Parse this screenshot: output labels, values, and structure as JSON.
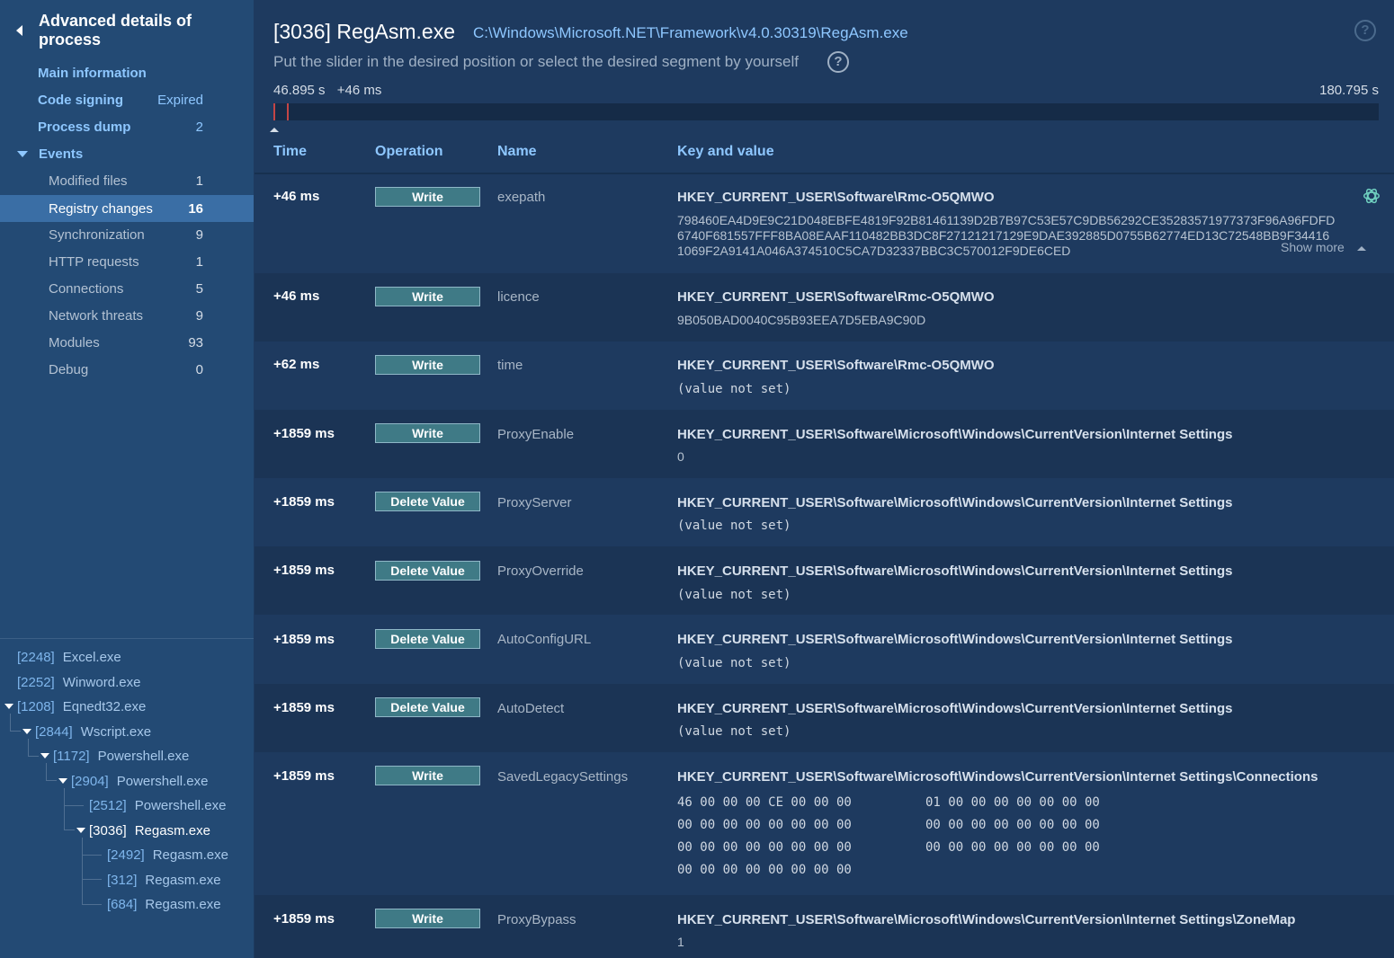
{
  "sidebar": {
    "title": "Advanced details of process",
    "main_items": [
      {
        "label": "Main information",
        "value": ""
      },
      {
        "label": "Code signing",
        "value": "Expired"
      },
      {
        "label": "Process dump",
        "value": "2"
      },
      {
        "label": "Events",
        "value": ""
      }
    ],
    "event_items": [
      {
        "label": "Modified files",
        "count": "1"
      },
      {
        "label": "Registry changes",
        "count": "16"
      },
      {
        "label": "Synchronization",
        "count": "9"
      },
      {
        "label": "HTTP requests",
        "count": "1"
      },
      {
        "label": "Connections",
        "count": "5"
      },
      {
        "label": "Network threats",
        "count": "9"
      },
      {
        "label": "Modules",
        "count": "93"
      },
      {
        "label": "Debug",
        "count": "0"
      }
    ],
    "tree": [
      {
        "pid": "[2248]",
        "name": "Excel.exe"
      },
      {
        "pid": "[2252]",
        "name": "Winword.exe"
      },
      {
        "pid": "[1208]",
        "name": "Eqnedt32.exe"
      },
      {
        "pid": "[2844]",
        "name": "Wscript.exe"
      },
      {
        "pid": "[1172]",
        "name": "Powershell.exe"
      },
      {
        "pid": "[2904]",
        "name": "Powershell.exe"
      },
      {
        "pid": "[2512]",
        "name": "Powershell.exe"
      },
      {
        "pid": "[3036]",
        "name": "Regasm.exe"
      },
      {
        "pid": "[2492]",
        "name": "Regasm.exe"
      },
      {
        "pid": "[312]",
        "name": "Regasm.exe"
      },
      {
        "pid": "[684]",
        "name": "Regasm.exe"
      }
    ]
  },
  "header": {
    "title": "[3036] RegAsm.exe",
    "path": "C:\\Windows\\Microsoft.NET\\Framework\\v4.0.30319\\RegAsm.exe",
    "hint": "Put the slider in the desired position or select the desired segment by yourself",
    "help_glyph": "?"
  },
  "timeline": {
    "start_label": "46.895 s",
    "offset_label": "+46 ms",
    "end_label": "180.795 s"
  },
  "table": {
    "columns": [
      "Time",
      "Operation",
      "Name",
      "Key and value"
    ],
    "show_more": "Show more",
    "rows": [
      {
        "time": "+46 ms",
        "op": "Write",
        "name": "exepath",
        "key": "HKEY_CURRENT_USER\\Software\\Rmc-O5QMWO",
        "value_lines": [
          "798460EA4D9E9C21D048EBFE4819F92B81461139D2B7B97C53E57C9DB56292CE35283571977373F96A96FDFD",
          "6740F681557FFF8BA08EAAF110482BB3DC8F27121217129E9DAE392885D0755B62774ED13C72548BB9F34416",
          "1069F2A9141A046A374510C5CA7D32337BBC3C570012F9DE6CED"
        ]
      },
      {
        "time": "+46 ms",
        "op": "Write",
        "name": "licence",
        "key": "HKEY_CURRENT_USER\\Software\\Rmc-O5QMWO",
        "value": "9B050BAD0040C95B93EEA7D5EBA9C90D"
      },
      {
        "time": "+62 ms",
        "op": "Write",
        "name": "time",
        "key": "HKEY_CURRENT_USER\\Software\\Rmc-O5QMWO",
        "value": "(value not set)"
      },
      {
        "time": "+1859 ms",
        "op": "Write",
        "name": "ProxyEnable",
        "key": "HKEY_CURRENT_USER\\Software\\Microsoft\\Windows\\CurrentVersion\\Internet Settings",
        "value": "0"
      },
      {
        "time": "+1859 ms",
        "op": "Delete Value",
        "name": "ProxyServer",
        "key": "HKEY_CURRENT_USER\\Software\\Microsoft\\Windows\\CurrentVersion\\Internet Settings",
        "value": "(value not set)"
      },
      {
        "time": "+1859 ms",
        "op": "Delete Value",
        "name": "ProxyOverride",
        "key": "HKEY_CURRENT_USER\\Software\\Microsoft\\Windows\\CurrentVersion\\Internet Settings",
        "value": "(value not set)"
      },
      {
        "time": "+1859 ms",
        "op": "Delete Value",
        "name": "AutoConfigURL",
        "key": "HKEY_CURRENT_USER\\Software\\Microsoft\\Windows\\CurrentVersion\\Internet Settings",
        "value": "(value not set)"
      },
      {
        "time": "+1859 ms",
        "op": "Delete Value",
        "name": "AutoDetect",
        "key": "HKEY_CURRENT_USER\\Software\\Microsoft\\Windows\\CurrentVersion\\Internet Settings",
        "value": "(value not set)"
      },
      {
        "time": "+1859 ms",
        "op": "Write",
        "name": "SavedLegacySettings",
        "key": "HKEY_CURRENT_USER\\Software\\Microsoft\\Windows\\CurrentVersion\\Internet Settings\\Connections",
        "hex_left": [
          "46 00 00 00 CE 00 00 00",
          "00 00 00 00 00 00 00 00",
          "00 00 00 00 00 00 00 00",
          "00 00 00 00 00 00 00 00"
        ],
        "hex_right": [
          "01 00 00 00 00 00 00 00",
          "00 00 00 00 00 00 00 00",
          "00 00 00 00 00 00 00 00"
        ]
      },
      {
        "time": "+1859 ms",
        "op": "Write",
        "name": "ProxyBypass",
        "key": "HKEY_CURRENT_USER\\Software\\Microsoft\\Windows\\CurrentVersion\\Internet Settings\\ZoneMap",
        "value": "1"
      }
    ]
  },
  "colors": {
    "sidebar_bg": "#234a74",
    "main_bg": "#1e3a5f",
    "accent": "#8ec7ff",
    "active_row": "#3a6ea5",
    "op_badge": "#3f7a86",
    "timeline_marker": "#c44545"
  }
}
